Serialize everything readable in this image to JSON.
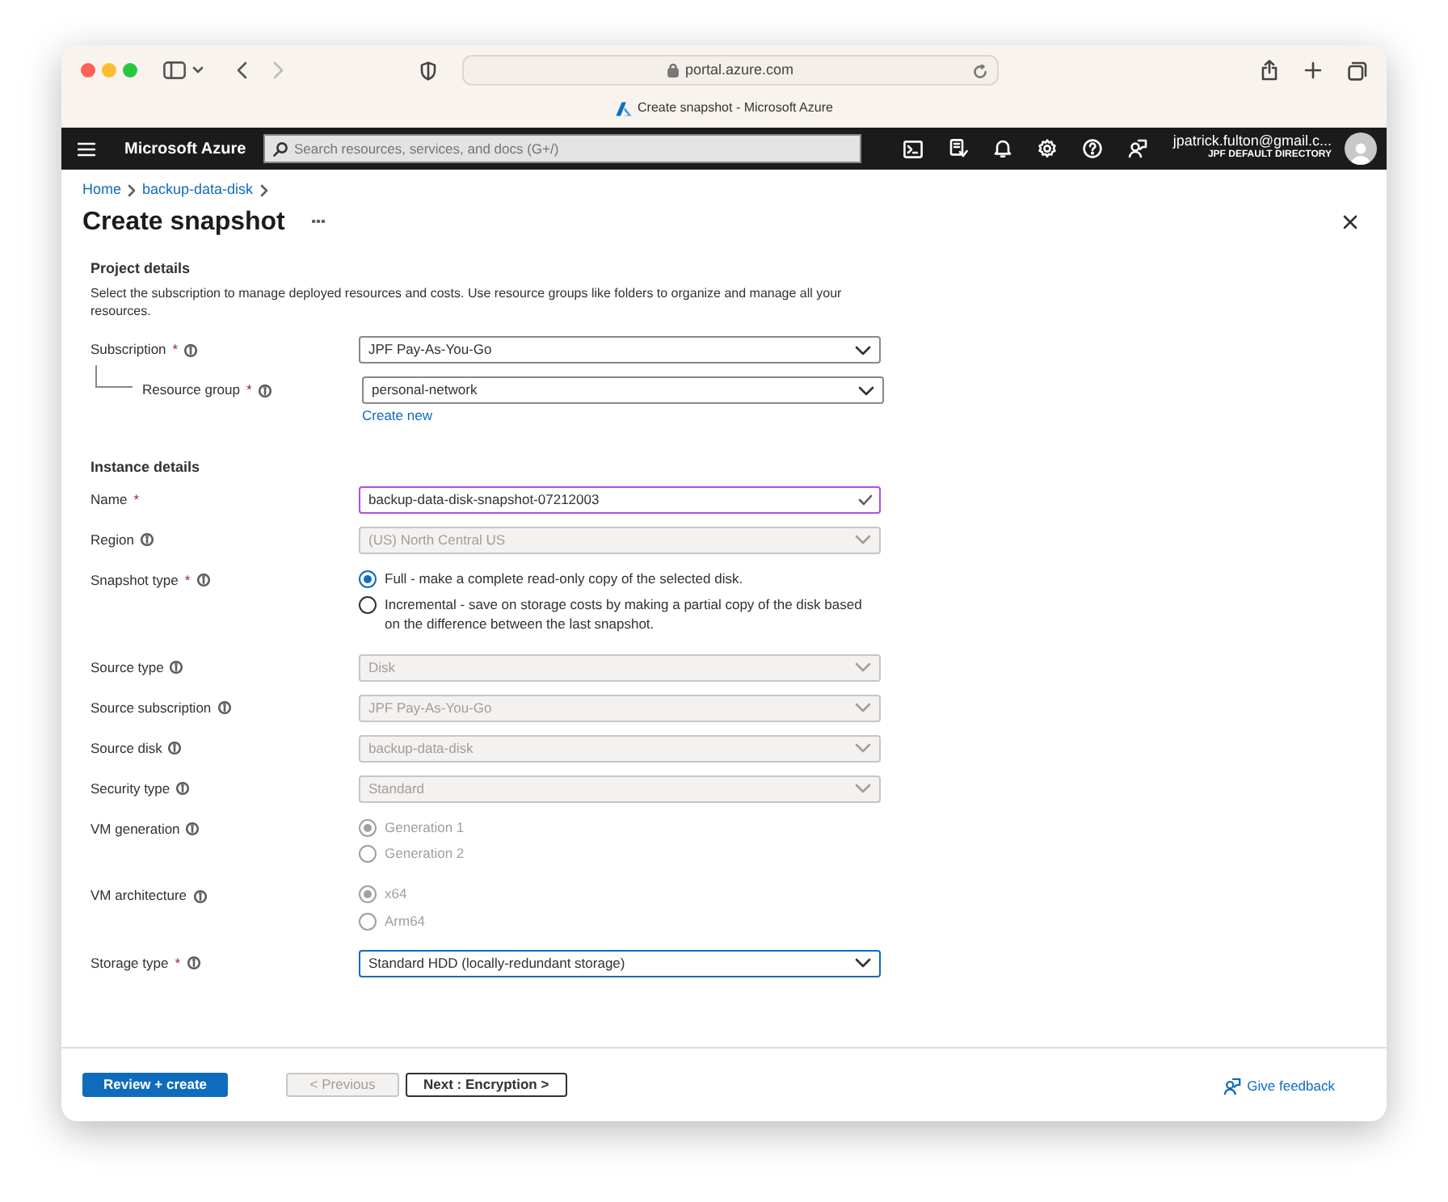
{
  "browser": {
    "address": "portal.azure.com",
    "tab_title": "Create snapshot - Microsoft Azure"
  },
  "header": {
    "brand": "Microsoft Azure",
    "search": {
      "placeholder": "Search resources, services, and docs (G+/)"
    },
    "account": {
      "email": "jpatrick.fulton@gmail.c...",
      "directory": "JPF DEFAULT DIRECTORY"
    }
  },
  "breadcrumb": [
    "Home",
    "backup-data-disk"
  ],
  "title": "Create snapshot",
  "required_marker": "*",
  "sections": [
    {
      "title": "Project details",
      "description": "Select the subscription to manage deployed resources and costs. Use resource groups like folders to organize and manage all your resources.",
      "fields": [
        {
          "label": "Subscription",
          "required": true,
          "info": true,
          "kind": "select",
          "value": "JPF Pay-As-You-Go",
          "disabled": false,
          "focused": false,
          "children": [
            {
              "label": "Resource group",
              "required": true,
              "info": true,
              "kind": "select",
              "value": "personal-network",
              "disabled": false,
              "focused": false,
              "link": "Create new"
            }
          ]
        }
      ]
    },
    {
      "title": "Instance details",
      "fields": [
        {
          "label": "Name",
          "required": true,
          "info": false,
          "kind": "text",
          "value": "backup-data-disk-snapshot-07212003",
          "valid": true,
          "focused": false
        },
        {
          "label": "Region",
          "required": false,
          "info": true,
          "kind": "select",
          "value": "(US) North Central US",
          "disabled": true,
          "focused": false
        },
        {
          "label": "Snapshot type",
          "required": true,
          "info": true,
          "kind": "radio",
          "disabled": false,
          "options": [
            {
              "label": "Full - make a complete read-only copy of the selected disk.",
              "selected": true
            },
            {
              "label": "Incremental - save on storage costs by making a partial copy of the disk based on the difference between the last snapshot.",
              "selected": false
            }
          ]
        },
        {
          "label": "Source type",
          "required": false,
          "info": true,
          "kind": "select",
          "value": "Disk",
          "disabled": true,
          "focused": false
        },
        {
          "label": "Source subscription",
          "required": false,
          "info": true,
          "kind": "select",
          "value": "JPF Pay-As-You-Go",
          "disabled": true,
          "focused": false
        },
        {
          "label": "Source disk",
          "required": false,
          "info": true,
          "kind": "select",
          "value": "backup-data-disk",
          "disabled": true,
          "focused": false
        },
        {
          "label": "Security type",
          "required": false,
          "info": true,
          "kind": "select",
          "value": "Standard",
          "disabled": true,
          "focused": false
        },
        {
          "label": "VM generation",
          "required": false,
          "info": true,
          "kind": "radio",
          "disabled": true,
          "options": [
            {
              "label": "Generation 1",
              "selected": true
            },
            {
              "label": "Generation 2",
              "selected": false
            }
          ]
        },
        {
          "label": "VM architecture",
          "required": false,
          "info": true,
          "kind": "radio",
          "disabled": true,
          "options": [
            {
              "label": "x64",
              "selected": true
            },
            {
              "label": "Arm64",
              "selected": false
            }
          ]
        },
        {
          "label": "Storage type",
          "required": true,
          "info": true,
          "kind": "select",
          "value": "Standard HDD (locally-redundant storage)",
          "disabled": false,
          "focused": true
        }
      ]
    }
  ],
  "footer": {
    "buttons": [
      {
        "label": "Review + create",
        "kind": "primary",
        "disabled": false
      },
      {
        "label": "< Previous",
        "kind": "secondary",
        "disabled": true
      },
      {
        "label": "Next : Encryption >",
        "kind": "secondary",
        "disabled": false
      }
    ],
    "feedback": "Give feedback"
  }
}
